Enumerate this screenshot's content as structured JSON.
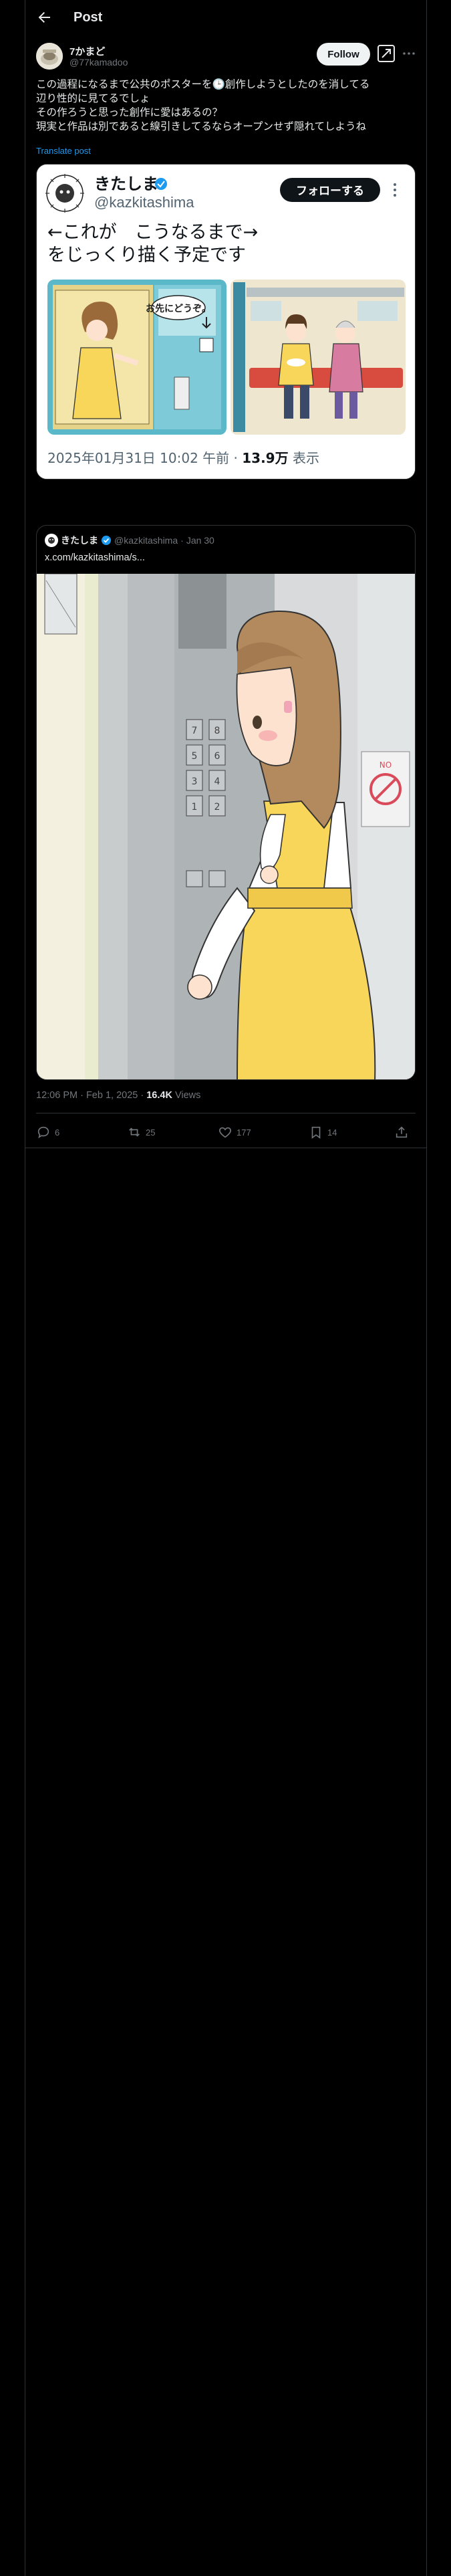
{
  "header": {
    "title": "Post"
  },
  "author": {
    "name": "7かまど",
    "handle": "@77kamadoo",
    "follow_label": "Follow"
  },
  "tweet": {
    "lines": [
      "この過程になるまで公共のポスターを🕒創作しようとしたのを消してる",
      "辺り性的に見てるでしょ",
      "その作ろうと思った創作に愛はあるの？",
      "現実と作品は別であると線引きしてるならオープンせず隠れてしようね"
    ],
    "translate_label": "Translate post"
  },
  "embedded_screenshot": {
    "name": "きたしま",
    "handle": "@kazkitashima",
    "follow_label": "フォローする",
    "text_line1": "←これが　こうなるまで→",
    "text_line2": "をじっくり描く予定です",
    "poster_bubble": "お先にどうぞ。",
    "meta_prefix": "2025年01月31日 10:02 午前 · ",
    "views_count": "13.9万",
    "views_label": " 表示"
  },
  "quote": {
    "name": "きたしま",
    "handle": "@kazkitashima",
    "separator": "·",
    "date": "Jan 30",
    "text": "x.com/kazkitashima/s..."
  },
  "post_meta": {
    "time": "12:06 PM · Feb 1, 2025 · ",
    "views": "16.4K",
    "views_label": " Views"
  },
  "actions": {
    "replies": "6",
    "reposts": "25",
    "likes": "177",
    "bookmarks": "14"
  },
  "colors": {
    "background": "#000000",
    "text": "#e7e9ea",
    "muted": "#71767b",
    "link": "#1d9bf0",
    "border": "#2f3336",
    "verified": "#1d9bf0",
    "dress_yellow": "#f7d65a"
  }
}
